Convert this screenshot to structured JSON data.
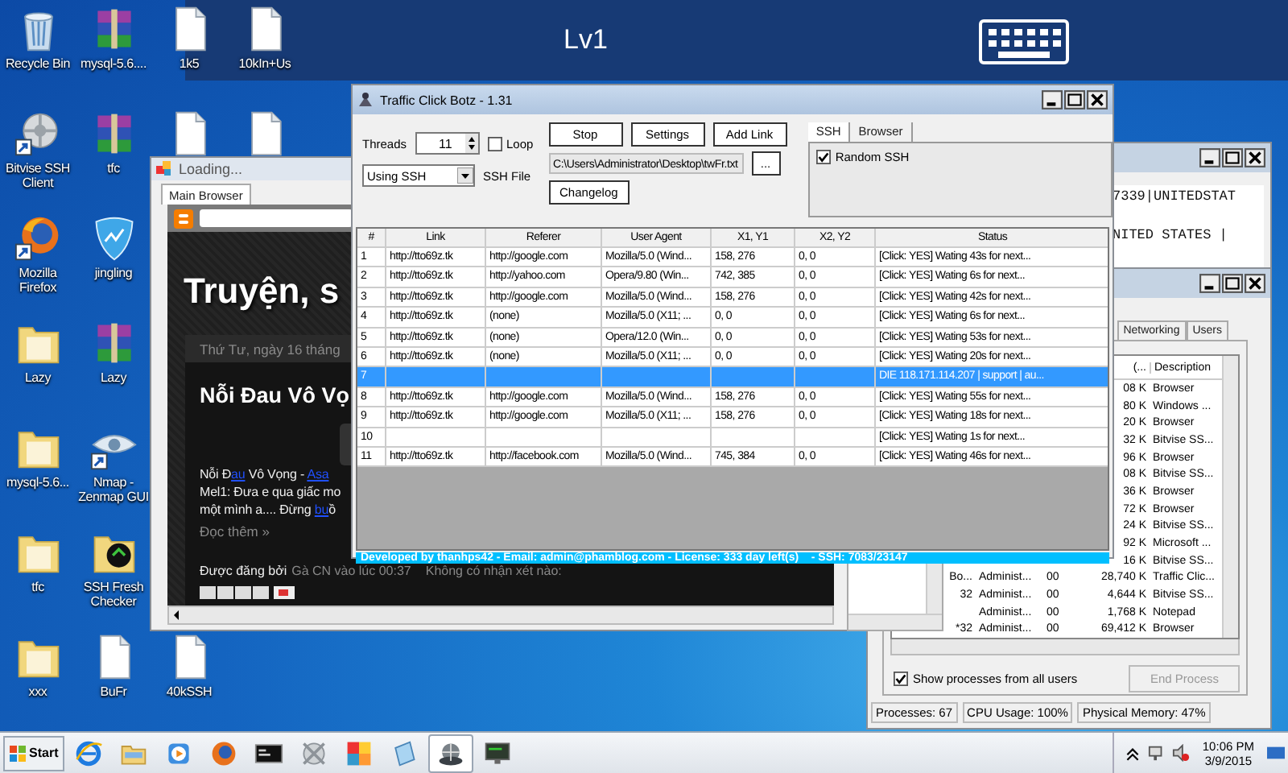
{
  "remote_bar": {
    "title": "Lv1"
  },
  "desktop_icons": [
    {
      "kind": "recycle",
      "label": "Recycle Bin"
    },
    {
      "kind": "archive",
      "label": "mysql-5.6...."
    },
    {
      "kind": "document",
      "label": "1k5"
    },
    {
      "kind": "document",
      "label": "10kIn+Us"
    },
    {
      "kind": "gear",
      "label": "Bitvise SSH Client"
    },
    {
      "kind": "archive",
      "label": "tfc"
    },
    {
      "kind": "document"
    },
    {
      "kind": "document"
    },
    {
      "kind": "firefox",
      "label": "Mozilla Firefox"
    },
    {
      "kind": "shield",
      "label": "jingling"
    },
    {
      "kind": "folder",
      "label": "Lazy"
    },
    {
      "kind": "archive",
      "label": "Lazy"
    },
    {
      "kind": "folder",
      "label": "mysql-5.6..."
    },
    {
      "kind": "eye",
      "label": "Nmap - Zenmap GUI"
    },
    {
      "kind": "folder",
      "label": "tfc"
    },
    {
      "kind": "checker",
      "label": "SSH Fresh Checker"
    },
    {
      "kind": "folder",
      "label": "xxx"
    },
    {
      "kind": "document",
      "label": "BuFr"
    },
    {
      "kind": "document",
      "label": "40kSSH"
    }
  ],
  "browser_window": {
    "title": "Loading...",
    "tabs": [
      {
        "label": "Main Browser",
        "selected": true
      }
    ],
    "blog_title": "Truyện, s",
    "post_date": "Thứ Tư, ngày 16 tháng",
    "post_title": "Nỗi Đau Vô Vọ",
    "excerpt_lines": [
      [
        {
          "text": "Nỗi Đ",
          "link": false
        },
        {
          "text": "au",
          "link": true
        },
        {
          "text": " Vô Vọng - ",
          "link": false
        },
        {
          "text": "Asa",
          "link": true
        }
      ],
      [
        {
          "text": "Mel1: Đưa e qua giấc mo",
          "link": false
        }
      ],
      [
        {
          "text": "một mình a.... Đừng ",
          "link": false
        },
        {
          "text": "bu",
          "link": true
        },
        {
          "text": "ồ",
          "link": false
        }
      ]
    ],
    "read_more": "Đọc thêm »",
    "byline_label": "Được đăng bởi",
    "byline_author": "Gà CN vào lúc 00:37",
    "comments": "Không có nhận xét nào:"
  },
  "info_window": {
    "lines": [
      "7339|UNITEDSTAT",
      "NITED STATES |"
    ]
  },
  "task_manager": {
    "tabs": [
      {
        "label": "Networking",
        "selected": false
      },
      {
        "label": "Users",
        "selected": false
      }
    ],
    "columns": [
      "(...",
      "Description"
    ],
    "rows": [
      {
        "memory": "08 K",
        "description": "Browser"
      },
      {
        "memory": "80 K",
        "description": "Windows ..."
      },
      {
        "memory": "20 K",
        "description": "Browser"
      },
      {
        "memory": "32 K",
        "description": "Bitvise SS..."
      },
      {
        "memory": "96 K",
        "description": "Browser"
      },
      {
        "memory": "08 K",
        "description": "Bitvise SS..."
      },
      {
        "memory": "36 K",
        "description": "Browser"
      },
      {
        "memory": "72 K",
        "description": "Browser"
      },
      {
        "memory": "24 K",
        "description": "Bitvise SS..."
      },
      {
        "memory": "92 K",
        "description": "Microsoft ..."
      },
      {
        "memory": "16 K",
        "description": "Bitvise SS..."
      },
      {
        "image": "Bo...",
        "user": "Administ...",
        "cpu": "00",
        "memory": "28,740 K",
        "description": "Traffic Clic..."
      },
      {
        "image": "32",
        "user": "Administ...",
        "cpu": "00",
        "memory": "4,644 K",
        "description": "Bitvise SS..."
      },
      {
        "user": "Administ...",
        "cpu": "00",
        "memory": "1,768 K",
        "description": "Notepad"
      },
      {
        "image": "*32",
        "user": "Administ...",
        "cpu": "00",
        "memory": "69,412 K",
        "description": "Browser"
      }
    ],
    "show_all": {
      "label": "Show processes from all users",
      "checked": true
    },
    "end_process": {
      "label": "End Process",
      "disabled": true
    },
    "status": [
      "Processes: 67",
      "CPU Usage: 100%",
      "Physical Memory: 47%"
    ]
  },
  "main_window": {
    "title": "Traffic Click Botz - 1.31",
    "threads": {
      "label": "Threads",
      "value": "11"
    },
    "loop": {
      "label": "Loop",
      "checked": false
    },
    "buttons": [
      "Stop",
      "Settings",
      "Add Link"
    ],
    "mode": {
      "value": "Using SSH"
    },
    "ssh_file": {
      "label": "SSH File",
      "value": "C:\\Users\\Administrator\\Desktop\\twFr.txt",
      "browse": "..."
    },
    "changelog": "Changelog",
    "side_tabs": [
      {
        "label": "SSH",
        "selected": true
      },
      {
        "label": "Browser",
        "selected": false
      }
    ],
    "random_ssh": {
      "label": "Random SSH",
      "checked": true
    },
    "table": {
      "columns": [
        "#",
        "Link",
        "Referer",
        "User Agent",
        "X1, Y1",
        "X2, Y2",
        "Status"
      ],
      "rows": [
        {
          "num": "1",
          "link": "http://tto69z.tk",
          "referer": "http://google.com",
          "agent": "Mozilla/5.0 (Wind...",
          "xy1": "158, 276",
          "xy2": "0, 0",
          "status": "[Click: YES] Wating 43s for next...",
          "selected": false
        },
        {
          "num": "2",
          "link": "http://tto69z.tk",
          "referer": "http://yahoo.com",
          "agent": "Opera/9.80 (Win...",
          "xy1": "742, 385",
          "xy2": "0, 0",
          "status": "[Click: YES] Wating 6s for next...",
          "selected": false
        },
        {
          "num": "3",
          "link": "http://tto69z.tk",
          "referer": "http://google.com",
          "agent": "Mozilla/5.0 (Wind...",
          "xy1": "158, 276",
          "xy2": "0, 0",
          "status": "[Click: YES] Wating 42s for next...",
          "selected": false
        },
        {
          "num": "4",
          "link": "http://tto69z.tk",
          "referer": "(none)",
          "agent": "Mozilla/5.0 (X11; ...",
          "xy1": "0, 0",
          "xy2": "0, 0",
          "status": "[Click: YES] Wating 6s for next...",
          "selected": false
        },
        {
          "num": "5",
          "link": "http://tto69z.tk",
          "referer": "(none)",
          "agent": "Opera/12.0 (Win...",
          "xy1": "0, 0",
          "xy2": "0, 0",
          "status": "[Click: YES] Wating 53s for next...",
          "selected": false
        },
        {
          "num": "6",
          "link": "http://tto69z.tk",
          "referer": "(none)",
          "agent": "Mozilla/5.0 (X11; ...",
          "xy1": "0, 0",
          "xy2": "0, 0",
          "status": "[Click: YES] Wating 20s for next...",
          "selected": false
        },
        {
          "num": "7",
          "status": "DIE 118.171.114.207 | support | au...",
          "selected": true
        },
        {
          "num": "8",
          "link": "http://tto69z.tk",
          "referer": "http://google.com",
          "agent": "Mozilla/5.0 (Wind...",
          "xy1": "158, 276",
          "xy2": "0, 0",
          "status": "[Click: YES] Wating 55s for next...",
          "selected": false
        },
        {
          "num": "9",
          "link": "http://tto69z.tk",
          "referer": "http://google.com",
          "agent": "Mozilla/5.0 (X11; ...",
          "xy1": "158, 276",
          "xy2": "0, 0",
          "status": "[Click: YES] Wating 18s for next...",
          "selected": false
        },
        {
          "num": "10",
          "status": "[Click: YES] Wating 1s for next...",
          "selected": false
        },
        {
          "num": "11",
          "link": "http://tto69z.tk",
          "referer": "http://facebook.com",
          "agent": "Mozilla/5.0 (Wind...",
          "xy1": "745, 384",
          "xy2": "0, 0",
          "status": "[Click: YES] Wating 46s for next...",
          "selected": false
        }
      ]
    },
    "status_bar": "Developed by thanhps42 - Email: admin@phamblog.com - License: 333 day left(s)    - SSH: 7083/23147"
  },
  "taskbar": {
    "start": "Start",
    "items": [
      {
        "kind": "ie",
        "selected": false
      },
      {
        "kind": "folder",
        "selected": false
      },
      {
        "kind": "media",
        "selected": false
      },
      {
        "kind": "firefox",
        "selected": false
      },
      {
        "kind": "terminal",
        "selected": false
      },
      {
        "kind": "gear",
        "selected": false
      },
      {
        "kind": "squares",
        "selected": false
      },
      {
        "kind": "notepad",
        "selected": false
      },
      {
        "kind": "globe",
        "selected": true
      },
      {
        "kind": "monitor",
        "selected": false
      }
    ],
    "time": "10:06 PM",
    "date": "3/9/2015"
  }
}
